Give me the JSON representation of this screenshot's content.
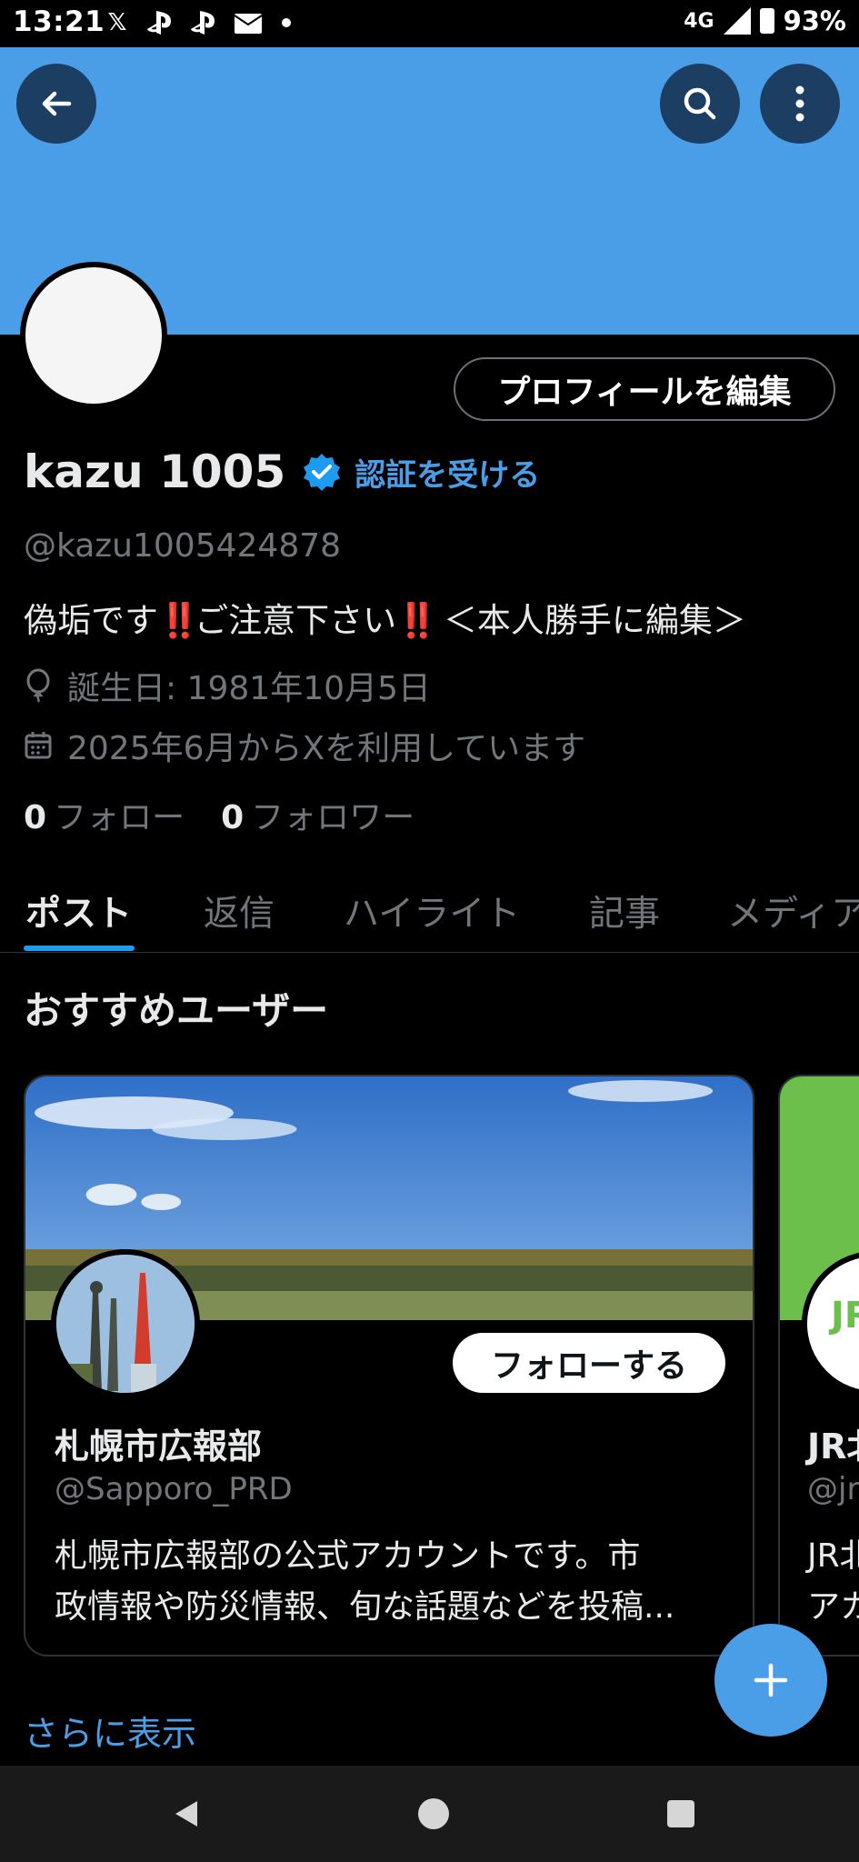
{
  "status_bar": {
    "time": "13:21",
    "left_icons": [
      "x-icon",
      "playstation-icon",
      "playstation-icon",
      "au-mail-icon",
      "dot"
    ],
    "x_glyph": "𝕏",
    "network": "4G",
    "battery": "93%"
  },
  "header": {
    "back_icon": "back-arrow-icon",
    "search_icon": "search-icon",
    "more_icon": "more-vertical-icon",
    "banner_color": "#4a9ee8"
  },
  "profile": {
    "edit_button": "プロフィールを編集",
    "display_name": "kazu 1005",
    "verify_link": "認証を受ける",
    "handle": "@kazu1005424878",
    "bio_part1": "偽垢です",
    "bio_bang1": "‼️",
    "bio_part2": "ご注意下さい",
    "bio_bang2": "‼️",
    "bio_part3": " ＜本人勝手に編集＞",
    "birthday": "誕生日: 1981年10月5日",
    "joined": "2025年6月からXを利用しています",
    "following_count": "0",
    "following_label": "フォロー",
    "followers_count": "0",
    "followers_label": "フォロワー"
  },
  "tabs": [
    {
      "label": "ポスト",
      "active": true
    },
    {
      "label": "返信",
      "active": false
    },
    {
      "label": "ハイライト",
      "active": false
    },
    {
      "label": "記事",
      "active": false
    },
    {
      "label": "メディア",
      "active": false
    }
  ],
  "recommended": {
    "title": "おすすめユーザー",
    "cards": [
      {
        "name": "札幌市広報部",
        "handle": "@Sapporo_PRD",
        "follow_button": "フォローする",
        "desc_line1": "札幌市広報部の公式アカウントです。市",
        "desc_line2": "政情報や防災情報、旬な話題などを投稿..."
      },
      {
        "name": "JR北",
        "handle": "@jr",
        "desc_line1": "JR北",
        "desc_line2": "アカ",
        "logo_text": "JR"
      }
    ],
    "show_more": "さらに表示"
  },
  "fab": {
    "icon": "plus-icon"
  },
  "nav_bar": {
    "back_icon": "nav-back-icon",
    "home_icon": "nav-home-icon",
    "recent_icon": "nav-recent-icon"
  },
  "colors": {
    "accent": "#1d9bf0",
    "link": "#4a9ee8",
    "muted": "#71767b",
    "text": "#e7e9ea",
    "alert": "#e0245e"
  }
}
